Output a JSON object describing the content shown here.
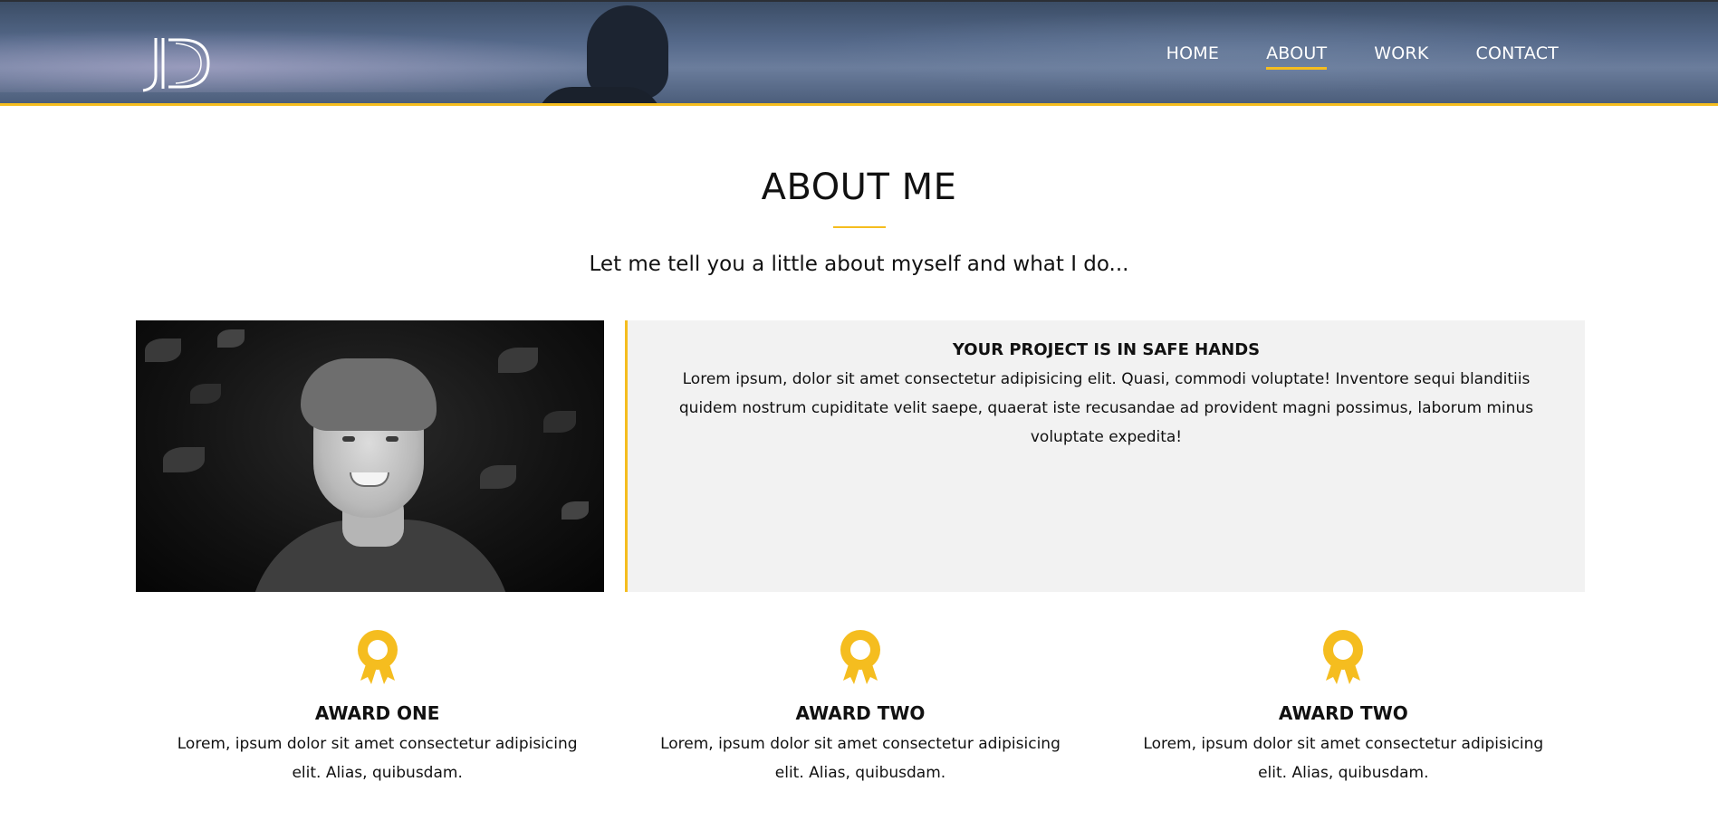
{
  "colors": {
    "accent": "#f5bd1f",
    "header_bg": "#4c5e7b",
    "panel_bg": "#f2f2f2",
    "text": "#111111"
  },
  "header": {
    "logo_text": "JD",
    "nav": [
      {
        "label": "HOME",
        "active": false
      },
      {
        "label": "ABOUT",
        "active": true
      },
      {
        "label": "WORK",
        "active": false
      },
      {
        "label": "CONTACT",
        "active": false
      }
    ]
  },
  "about": {
    "title": "ABOUT ME",
    "subtitle": "Let me tell you a little about myself and what I do...",
    "photo_icon": "portrait-photo",
    "info_heading": "YOUR PROJECT IS IN SAFE HANDS",
    "info_text": "Lorem ipsum, dolor sit amet consectetur adipisicing elit. Quasi, commodi voluptate! Inventore sequi blanditiis quidem nostrum cupiditate velit saepe, quaerat iste recusandae ad provident magni possimus, laborum minus voluptate expedita!"
  },
  "awards": [
    {
      "icon": "award-ribbon-icon",
      "title": "AWARD ONE",
      "text": "Lorem, ipsum dolor sit amet consectetur adipisicing elit. Alias, quibusdam."
    },
    {
      "icon": "award-ribbon-icon",
      "title": "AWARD TWO",
      "text": "Lorem, ipsum dolor sit amet consectetur adipisicing elit. Alias, quibusdam."
    },
    {
      "icon": "award-ribbon-icon",
      "title": "AWARD TWO",
      "text": "Lorem, ipsum dolor sit amet consectetur adipisicing elit. Alias, quibusdam."
    }
  ]
}
